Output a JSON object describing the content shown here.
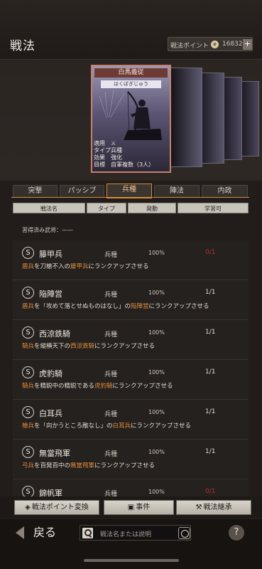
{
  "header": {
    "title": "戦法",
    "points_label": "戦法ポイント",
    "points_value": "16832",
    "plus": "+"
  },
  "card": {
    "name": "白馬義従",
    "reading": "はくばぎじゅう",
    "info": [
      {
        "key": "適用",
        "value": "⚔"
      },
      {
        "key": "タイプ",
        "value": "兵種"
      },
      {
        "key": "効果",
        "value": "強化"
      },
      {
        "key": "目標",
        "value": "自軍複数（3人）"
      }
    ]
  },
  "tabs": [
    "突撃",
    "パッシブ",
    "兵種",
    "陣法",
    "内政"
  ],
  "active_tab": "兵種",
  "columns": [
    "戦法名",
    "タイプ",
    "発動",
    "学習可"
  ],
  "learned_label": "習得済み武将：——",
  "items": [
    {
      "badge": "S",
      "name": "籐甲兵",
      "type": "兵種",
      "rate": "100%",
      "learn": "0/1",
      "learn_red": true,
      "desc": [
        {
          "t": "盾兵",
          "h": true
        },
        {
          "t": "を刀槍不入の"
        },
        {
          "t": "籐甲兵",
          "h": true
        },
        {
          "t": "にランクアップさせる"
        }
      ]
    },
    {
      "badge": "S",
      "name": "陥陣営",
      "type": "兵種",
      "rate": "100%",
      "learn": "1/1",
      "learn_red": false,
      "desc": [
        {
          "t": "盾兵",
          "h": true
        },
        {
          "t": "を「攻めて落とせぬものはなし」の"
        },
        {
          "t": "陥陣営",
          "h": true
        },
        {
          "t": "にランクアップさせる"
        }
      ]
    },
    {
      "badge": "S",
      "name": "西涼鉄騎",
      "type": "兵種",
      "rate": "100%",
      "learn": "1/1",
      "learn_red": false,
      "desc": [
        {
          "t": "騎兵",
          "h": true
        },
        {
          "t": "を縦横天下の"
        },
        {
          "t": "西涼鉄騎",
          "h": true
        },
        {
          "t": "にランクアップさせる"
        }
      ]
    },
    {
      "badge": "S",
      "name": "虎豹騎",
      "type": "兵種",
      "rate": "100%",
      "learn": "1/1",
      "learn_red": false,
      "desc": [
        {
          "t": "騎兵",
          "h": true
        },
        {
          "t": "を精鋭中の精鋭である"
        },
        {
          "t": "虎豹騎",
          "h": true
        },
        {
          "t": "にランクアップさせる"
        }
      ]
    },
    {
      "badge": "S",
      "name": "白耳兵",
      "type": "兵種",
      "rate": "100%",
      "learn": "1/1",
      "learn_red": false,
      "desc": [
        {
          "t": "槍兵",
          "h": true
        },
        {
          "t": "を「向かうところ敵なし」の"
        },
        {
          "t": "白耳兵",
          "h": true
        },
        {
          "t": "にランクアップさせる"
        }
      ]
    },
    {
      "badge": "S",
      "name": "無當飛軍",
      "type": "兵種",
      "rate": "100%",
      "learn": "1/1",
      "learn_red": false,
      "desc": [
        {
          "t": "弓兵",
          "h": true
        },
        {
          "t": "を百発百中の"
        },
        {
          "t": "無當飛軍",
          "h": true
        },
        {
          "t": "にランクアップさせる"
        }
      ]
    },
    {
      "badge": "S",
      "name": "錦帆軍",
      "type": "兵種",
      "rate": "100%",
      "learn": "0/1",
      "learn_red": true,
      "desc": [
        {
          "t": "弓兵",
          "h": true
        },
        {
          "t": "を意気盛んな"
        },
        {
          "t": "錦帆軍",
          "h": true
        },
        {
          "t": "にランクアップさせる"
        }
      ]
    }
  ],
  "buttons": {
    "convert": "戦法ポイント変換",
    "event": "事件",
    "inherit": "戦法継承"
  },
  "footer": {
    "back": "戻る",
    "search_placeholder": "戦法名または説明",
    "help": "?"
  },
  "colors": {
    "accent": "#d98a3a",
    "highlight": "#e08b3d",
    "card_border": "#c9806a",
    "red": "#b8322b"
  }
}
